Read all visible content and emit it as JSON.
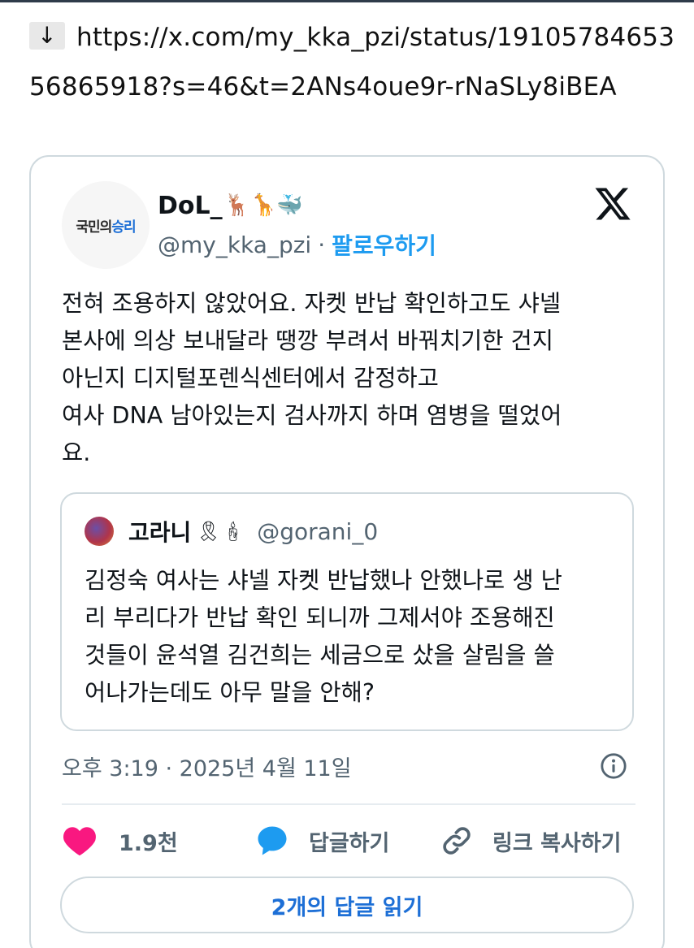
{
  "link": {
    "arrow_glyph": "↓",
    "url": "https://x.com/my_kka_pzi/status/1910578465356865918?s=46&t=2ANs4oue9r-rNaSLy8iBEA"
  },
  "tweet": {
    "avatar_text_a": "국민의",
    "avatar_text_b": "승리",
    "display_name": "DoL_",
    "name_emojis": "🦌🦒🐳",
    "handle": "@my_kka_pzi",
    "separator": "·",
    "follow_label": "팔로우하기",
    "text": "전혀 조용하지 않았어요. 자켓 반납 확인하고도 샤넬\n본사에 의상 보내달라 땡깡 부려서 바꿔치기한 건지\n아닌지 디지털포렌식센터에서 감정하고\n여사 DNA 남아있는지 검사까지 하며 염병을 떨었어\n요.",
    "quoted": {
      "display_name": "고라니",
      "name_emojis": "🎗🕯",
      "handle": "@gorani_0",
      "text": "김정숙 여사는 샤넬 자켓 반납했나 안했나로 생 난\n리 부리다가 반납 확인 되니까 그제서야 조용해진\n것들이 윤석열 김건희는 세금으로 샀을 살림을 쓸\n어나가는데도 아무 말을 안해?"
    },
    "timestamp": "오후 3:19 · 2025년 4월 11일",
    "like_count": "1.9천",
    "reply_label": "답글하기",
    "copy_link_label": "링크 복사하기",
    "read_replies_label": "2개의 답글 읽기"
  },
  "icons": {
    "x_logo": "x-logo-icon",
    "info": "info-icon",
    "heart": "heart-icon",
    "reply": "speech-bubble-icon",
    "link": "link-icon"
  },
  "colors": {
    "accent_blue": "#1d9bf0",
    "like_pink": "#f91880",
    "muted_text": "#536471",
    "border": "#cfd9de"
  }
}
